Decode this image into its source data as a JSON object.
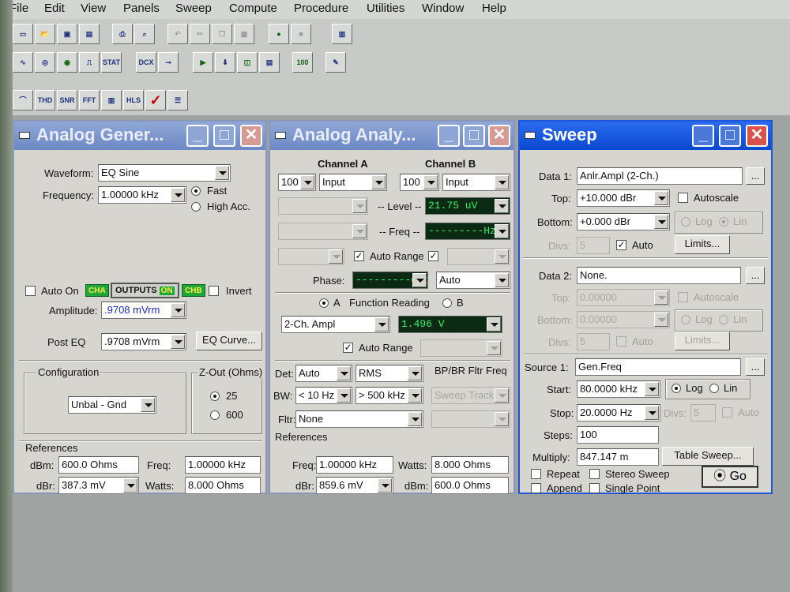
{
  "menu": [
    "File",
    "Edit",
    "View",
    "Panels",
    "Sweep",
    "Compute",
    "Procedure",
    "Utilities",
    "Window",
    "Help"
  ],
  "toolbar": {
    "row2_labels": [
      "STAT BIT",
      "DCX",
      "100"
    ],
    "row3_labels": [
      "THD",
      "SNR",
      "FFT",
      "HLS"
    ]
  },
  "gen": {
    "title": "Analog Gener...",
    "waveform_label": "Waveform:",
    "waveform": "EQ Sine",
    "frequency_label": "Frequency:",
    "frequency": "1.00000 kHz",
    "fast": "Fast",
    "high_acc": "High Acc.",
    "auto_on": "Auto On",
    "cha": "CHA",
    "outputs": "OUTPUTS",
    "on": "ON",
    "chb": "CHB",
    "invert": "Invert",
    "amplitude_label": "Amplitude:",
    "amplitude": ".9708  mVrm",
    "post_eq_label": "Post EQ",
    "post_eq": ".9708  mVrm",
    "eq_curve": "EQ Curve...",
    "configuration": "Configuration",
    "config_value": "Unbal - Gnd",
    "zout": "Z-Out (Ohms)",
    "z25": "25",
    "z600": "600",
    "references": "References",
    "dbm_label": "dBm:",
    "dbm": "600.0    Ohms",
    "freq_label": "Freq:",
    "freq": "1.00000 kHz",
    "dbr_label": "dBr:",
    "dbr": "387.3   mV",
    "watts_label": "Watts:",
    "watts": "8.000    Ohms"
  },
  "ana": {
    "title": "Analog Analy...",
    "channel_a": "Channel A",
    "channel_b": "Channel B",
    "a_range": "100",
    "a_input": "Input",
    "b_range": "100",
    "b_input": "Input",
    "level_label": "-- Level --",
    "level": "21.75   uV",
    "freq_label": "-- Freq --",
    "freq": "---------Hz",
    "auto_range": "Auto Range",
    "phase_label": "Phase:",
    "phase": "---------deg",
    "phase_mode": "Auto",
    "a_radio": "A",
    "function_reading": "Function Reading",
    "b_radio": "B",
    "function": "2-Ch. Ampl",
    "reading": "1.496    V",
    "auto_range2": "Auto Range",
    "det_label": "Det:",
    "det": "Auto",
    "rms": "RMS",
    "bpbr": "BP/BR Fltr Freq",
    "bw_label": "BW:",
    "bw_low": "< 10 Hz",
    "bw_high": "> 500 kHz",
    "sweep_track": "Sweep Track",
    "fltr_label": "Fltr:",
    "fltr": "None",
    "references": "References",
    "ref_freq_label": "Freq:",
    "ref_freq": "1.00000 kHz",
    "ref_watts_label": "Watts:",
    "ref_watts": "8.000    Ohms",
    "ref_dbr_label": "dBr:",
    "ref_dbr": "859.6   mV",
    "ref_dbm_label": "dBm:",
    "ref_dbm": "600.0    Ohms"
  },
  "sweep": {
    "title": "Sweep",
    "data1_label": "Data 1:",
    "data1": "Anlr.Ampl (2-Ch.)",
    "top_label": "Top:",
    "top": "+10.000  dBr",
    "autoscale": "Autoscale",
    "bottom_label": "Bottom:",
    "bottom": "+0.000   dBr",
    "log": "Log",
    "lin": "Lin",
    "divs_label": "Divs:",
    "divs": "5",
    "auto": "Auto",
    "limits": "Limits...",
    "data2_label": "Data 2:",
    "data2": "None.",
    "top2": "0.00000",
    "bottom2": "0.00000",
    "divs2": "5",
    "source1_label": "Source 1:",
    "source1": "Gen.Freq",
    "start_label": "Start:",
    "start": "80.0000 kHz",
    "stop_label": "Stop:",
    "stop": "20.0000  Hz",
    "divs3": "5",
    "steps_label": "Steps:",
    "steps": "100",
    "multiply_label": "Multiply:",
    "multiply": "847.147 m",
    "table_sweep": "Table Sweep...",
    "repeat": "Repeat",
    "stereo_sweep": "Stereo Sweep",
    "append": "Append",
    "single_point": "Single Point",
    "go": "Go"
  },
  "dots": "..."
}
